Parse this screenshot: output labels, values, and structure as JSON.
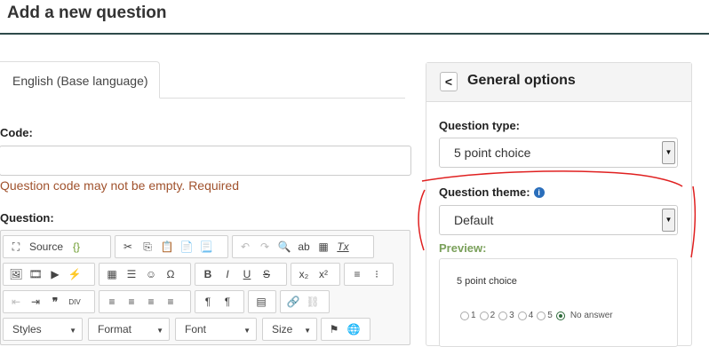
{
  "page": {
    "title": "Add a new question"
  },
  "language_tab": {
    "label": "English (Base language)"
  },
  "code": {
    "label": "Code:",
    "value": "",
    "error": "Question code may not be empty. Required"
  },
  "question": {
    "label": "Question:"
  },
  "editor": {
    "row1": [
      {
        "name": "maximize-icon",
        "glyph": "⛶"
      },
      {
        "name": "source-button",
        "glyph": "Source"
      },
      {
        "name": "cut-icon",
        "glyph": "✂"
      },
      {
        "name": "copy-icon",
        "glyph": "⎘"
      },
      {
        "name": "paste-icon",
        "glyph": "📋"
      },
      {
        "name": "paste-text-icon",
        "glyph": "📄"
      },
      {
        "name": "paste-word-icon",
        "glyph": "📃"
      },
      {
        "name": "undo-icon",
        "glyph": "↶"
      },
      {
        "name": "redo-icon",
        "glyph": "↷"
      },
      {
        "name": "find-icon",
        "glyph": "🔍"
      },
      {
        "name": "replace-icon",
        "glyph": "ab"
      },
      {
        "name": "select-all-icon",
        "glyph": "▦"
      },
      {
        "name": "remove-format-icon",
        "glyph": "Tx"
      }
    ],
    "row2": [
      {
        "name": "image-icon",
        "glyph": "🖼"
      },
      {
        "name": "video-icon",
        "glyph": "🎞"
      },
      {
        "name": "play-icon",
        "glyph": "▶"
      },
      {
        "name": "flash-icon",
        "glyph": "⚡"
      },
      {
        "name": "table-icon",
        "glyph": "▦"
      },
      {
        "name": "horizontal-line-icon",
        "glyph": "☰"
      },
      {
        "name": "smiley-icon",
        "glyph": "☺"
      },
      {
        "name": "omega-icon",
        "glyph": "Ω"
      },
      {
        "name": "bold-icon",
        "glyph": "B"
      },
      {
        "name": "italic-icon",
        "glyph": "I"
      },
      {
        "name": "underline-icon",
        "glyph": "U"
      },
      {
        "name": "strike-icon",
        "glyph": "S"
      },
      {
        "name": "subscript-icon",
        "glyph": "x₂"
      },
      {
        "name": "superscript-icon",
        "glyph": "x²"
      },
      {
        "name": "numbered-list-icon",
        "glyph": "≡"
      },
      {
        "name": "bullet-list-icon",
        "glyph": "⁝"
      }
    ],
    "row3": [
      {
        "name": "outdent-icon",
        "glyph": "⇤"
      },
      {
        "name": "indent-icon",
        "glyph": "⇥"
      },
      {
        "name": "blockquote-icon",
        "glyph": "❞"
      },
      {
        "name": "div-icon",
        "glyph": "DIV"
      },
      {
        "name": "align-left-icon",
        "glyph": "≡"
      },
      {
        "name": "align-center-icon",
        "glyph": "≡"
      },
      {
        "name": "align-right-icon",
        "glyph": "≡"
      },
      {
        "name": "justify-icon",
        "glyph": "≡"
      },
      {
        "name": "ltr-icon",
        "glyph": "¶"
      },
      {
        "name": "rtl-icon",
        "glyph": "¶"
      },
      {
        "name": "template-icon",
        "glyph": "▤"
      },
      {
        "name": "link-icon",
        "glyph": "🔗"
      },
      {
        "name": "unlink-icon",
        "glyph": "⛓"
      }
    ],
    "combos": {
      "styles": "Styles",
      "format": "Format",
      "font": "Font",
      "size": "Size"
    },
    "row4_icons": [
      {
        "name": "flag-icon",
        "glyph": "⚑"
      },
      {
        "name": "globe-icon",
        "glyph": "🌐"
      }
    ]
  },
  "general_options": {
    "title": "General options",
    "back_glyph": "<",
    "question_type_label": "Question type:",
    "question_type_value": "5 point choice",
    "question_theme_label": "Question theme:",
    "question_theme_value": "Default",
    "info_glyph": "i",
    "preview_label": "Preview:",
    "preview": {
      "question_text": "5 point choice",
      "options": [
        "1",
        "2",
        "3",
        "4",
        "5",
        "No answer"
      ],
      "selected": "No answer"
    }
  },
  "colors": {
    "accent": "#2e4a4a",
    "error": "#a0522d",
    "preview_label": "#7aa05a",
    "annotation": "#e02020"
  }
}
